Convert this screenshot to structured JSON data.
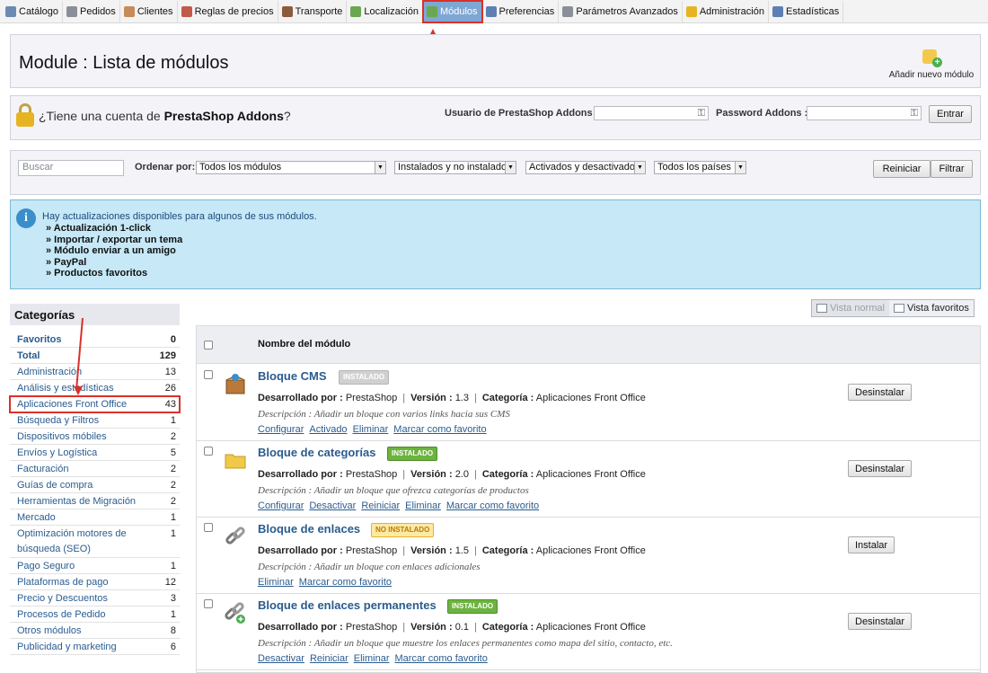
{
  "nav": {
    "tabs": [
      {
        "label": "Catálogo",
        "icon": "catalog-icon",
        "color": "#6b8bb3"
      },
      {
        "label": "Pedidos",
        "icon": "orders-icon",
        "color": "#8a8f98"
      },
      {
        "label": "Clientes",
        "icon": "customers-icon",
        "color": "#c78b58"
      },
      {
        "label": "Reglas de precios",
        "icon": "price-rules-icon",
        "color": "#c15a48"
      },
      {
        "label": "Transporte",
        "icon": "shipping-icon",
        "color": "#8c5a3c"
      },
      {
        "label": "Localización",
        "icon": "localization-icon",
        "color": "#6aa84f"
      },
      {
        "label": "Módulos",
        "icon": "modules-icon",
        "color": "#6aa84f"
      },
      {
        "label": "Preferencias",
        "icon": "preferences-icon",
        "color": "#5d7fb4"
      },
      {
        "label": "Parámetros Avanzados",
        "icon": "advanced-params-icon",
        "color": "#8a8f98"
      },
      {
        "label": "Administración",
        "icon": "administration-icon",
        "color": "#e6b422"
      },
      {
        "label": "Estadísticas",
        "icon": "stats-icon",
        "color": "#5d7fb4"
      }
    ],
    "active_index": 6
  },
  "header": {
    "title": "Module : Lista de módulos",
    "add_module_label": "Añadir nuevo módulo"
  },
  "addons": {
    "question_prefix": "¿Tiene una cuenta de ",
    "question_brand": "PrestaShop Addons",
    "question_suffix": "?",
    "user_label": "Usuario de PrestaShop Addons :",
    "password_label": "Password Addons :",
    "submit_label": "Entrar"
  },
  "filter": {
    "search_placeholder": "Buscar",
    "sort_label": "Ordenar por:",
    "module_select": "Todos los módulos",
    "install_select": "Instalados y no instalados",
    "active_select": "Activados y desactivados",
    "country_select": "Todos los países",
    "reset_label": "Reiniciar",
    "filter_label": "Filtrar"
  },
  "info": {
    "message": "Hay actualizaciones disponibles para algunos de sus módulos.",
    "items": [
      "» Actualización 1-click",
      "» Importar / exportar un tema",
      "» Módulo enviar a un amigo",
      "» PayPal",
      "» Productos favoritos"
    ]
  },
  "categories": {
    "heading": "Categorías",
    "items": [
      {
        "label": "Favoritos",
        "count": "0"
      },
      {
        "label": "Total",
        "count": "129"
      },
      {
        "label": "Administración",
        "count": "13"
      },
      {
        "label": "Análisis y estadísticas",
        "count": "26"
      },
      {
        "label": "Aplicaciones Front Office",
        "count": "43"
      },
      {
        "label": "Búsqueda y Filtros",
        "count": "1"
      },
      {
        "label": "Dispositivos móbiles",
        "count": "2"
      },
      {
        "label": "Envíos y Logística",
        "count": "5"
      },
      {
        "label": "Facturación",
        "count": "2"
      },
      {
        "label": "Guías de compra",
        "count": "2"
      },
      {
        "label": "Herramientas de Migración",
        "count": "2"
      },
      {
        "label": "Mercado",
        "count": "1"
      },
      {
        "label": "Optimización motores de búsqueda (SEO)",
        "count": "1"
      },
      {
        "label": "Pago Seguro",
        "count": "1"
      },
      {
        "label": "Plataformas de pago",
        "count": "12"
      },
      {
        "label": "Precio y Descuentos",
        "count": "3"
      },
      {
        "label": "Procesos de Pedido",
        "count": "1"
      },
      {
        "label": "Otros módulos",
        "count": "8"
      },
      {
        "label": "Publicidad y marketing",
        "count": "6"
      }
    ]
  },
  "view": {
    "normal_label": "Vista normal",
    "favorites_label": "Vista favoritos"
  },
  "modules": {
    "column_name": "Nombre del módulo",
    "developer_label": "Desarrollado por :",
    "version_label": "Versión :",
    "category_label": "Categoría :",
    "rows": [
      {
        "name": "Bloque CMS",
        "badge": "INSTALADO",
        "badge_style": "grey",
        "icon": "cms-box-icon",
        "developer": "PrestaShop",
        "version": "1.3",
        "category": "Aplicaciones Front Office",
        "description": "Descripción : Añadir un bloque con varios links hacia sus CMS",
        "links": [
          "Configurar",
          "Activado",
          "Eliminar",
          "Marcar como favorito"
        ],
        "action": "Desinstalar"
      },
      {
        "name": "Bloque de categorías",
        "badge": "INSTALADO",
        "badge_style": "green",
        "icon": "folder-icon",
        "developer": "PrestaShop",
        "version": "2.0",
        "category": "Aplicaciones Front Office",
        "description": "Descripción : Añadir un bloque que ofrezca categorías de productos",
        "links": [
          "Configurar",
          "Desactivar",
          "Reiniciar",
          "Eliminar",
          "Marcar como favorito"
        ],
        "action": "Desinstalar"
      },
      {
        "name": "Bloque de enlaces",
        "badge": "NO INSTALADO",
        "badge_style": "yellow",
        "icon": "chain-link-icon",
        "developer": "PrestaShop",
        "version": "1.5",
        "category": "Aplicaciones Front Office",
        "description": "Descripción : Añadir un bloque con enlaces adicionales",
        "links": [
          "Eliminar",
          "Marcar como favorito"
        ],
        "action": "Instalar"
      },
      {
        "name": "Bloque de enlaces permanentes",
        "badge": "INSTALADO",
        "badge_style": "green",
        "icon": "chain-link-add-icon",
        "developer": "PrestaShop",
        "version": "0.1",
        "category": "Aplicaciones Front Office",
        "description": "Descripción : Añadir un bloque que muestre los enlaces permanentes como mapa del sitio, contacto, etc.",
        "links": [
          "Desactivar",
          "Reiniciar",
          "Eliminar",
          "Marcar como favorito"
        ],
        "action": "Desinstalar"
      }
    ]
  }
}
